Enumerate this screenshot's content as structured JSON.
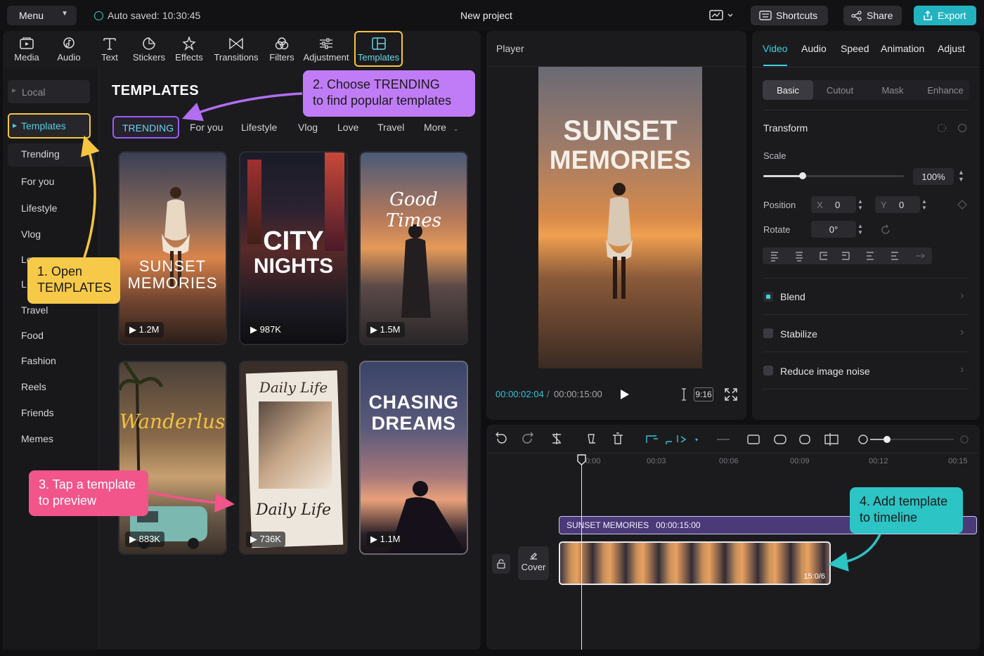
{
  "topbar": {
    "menu_label": "Menu",
    "autosave": "Auto saved: 10:30:45",
    "project_title": "New project",
    "shortcuts_label": "Shortcuts",
    "share_label": "Share",
    "export_label": "Export"
  },
  "toolbar": {
    "media": "Media",
    "audio": "Audio",
    "text": "Text",
    "stickers": "Stickers",
    "effects": "Effects",
    "transitions": "Transitions",
    "filters": "Filters",
    "adjustment": "Adjustment",
    "templates": "Templates"
  },
  "sidebar": {
    "local": "Local",
    "templates": "Templates",
    "items": [
      "Trending",
      "For you",
      "Lifestyle",
      "Vlog",
      "Lo",
      "L",
      "Travel",
      "Food",
      "Fashion",
      "Reels",
      "Friends",
      "Memes"
    ]
  },
  "main": {
    "title": "TEMPLATES",
    "categories": [
      "TRENDING",
      "For you",
      "Lifestyle",
      "Vlog",
      "Love",
      "Travel",
      "More"
    ],
    "cards": [
      {
        "title_line1": "SUNSET",
        "title_line2": "MEMORIES",
        "views": "1.2M"
      },
      {
        "title_line1": "CITY",
        "title_line2": "NIGHTS",
        "views": "987K"
      },
      {
        "title_line1": "Good Times",
        "title_line2": "",
        "views": "1.5M"
      },
      {
        "title_line1": "Wanderlust",
        "title_line2": "",
        "views": "883K"
      },
      {
        "title_line1": "Daily Life",
        "title_line2": "Daily Life",
        "views": "736K"
      },
      {
        "title_line1": "CHASING",
        "title_line2": "DREAMS",
        "views": "1.1M"
      }
    ]
  },
  "callouts": {
    "c1_line1": "1. Open",
    "c1_line2": "TEMPLATES",
    "c2_line1": "2. Choose TRENDING",
    "c2_line2": "to find popular templates",
    "c3_line1": "3. Tap a template",
    "c3_line2": "to preview",
    "c4_line1": "4. Add template",
    "c4_line2": "to timeline"
  },
  "player": {
    "label": "Player",
    "title_line1": "SUNSET",
    "title_line2": "MEMORIES",
    "current_time": "00:00:02:04",
    "separator": "/",
    "total_time": "00:00:15:00",
    "ratio": "9:16"
  },
  "props": {
    "tabs": [
      "Video",
      "Audio",
      "Speed",
      "Animation",
      "Adjust"
    ],
    "subtabs": [
      "Basic",
      "Cutout",
      "Mask",
      "Enhance"
    ],
    "transform": "Transform",
    "scale_label": "Scale",
    "scale_value": "100%",
    "scale_fraction": 0.28,
    "position_label": "Position",
    "x_label": "X",
    "x_value": "0",
    "y_label": "Y",
    "y_value": "0",
    "rotate_label": "Rotate",
    "rotate_value": "0°",
    "blend": "Blend",
    "stabilize": "Stabilize",
    "reduce_noise": "Reduce image noise"
  },
  "timeline": {
    "ticks": [
      "00:00",
      "00:03",
      "00:06",
      "00:09",
      "00:12",
      "00:15"
    ],
    "template_clip_title": "SUNSET MEMORIES",
    "template_clip_duration": "00:00:15:00",
    "video_clip_duration": "15:0/6",
    "cover_label": "Cover"
  },
  "colors": {
    "accent_teal": "#23b3c0",
    "callout_yellow": "#f7c948",
    "callout_purple": "#c07cf6",
    "callout_pink": "#f2558a",
    "callout_teal": "#2cc4c4"
  }
}
